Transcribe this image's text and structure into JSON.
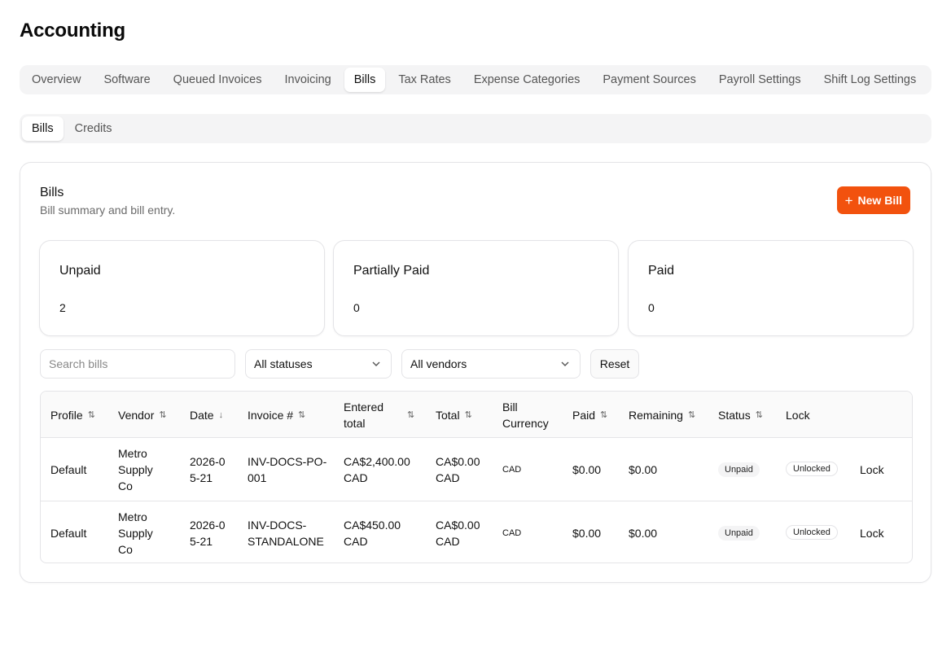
{
  "page": {
    "title": "Accounting"
  },
  "tabs": [
    {
      "label": "Overview",
      "active": false
    },
    {
      "label": "Software",
      "active": false
    },
    {
      "label": "Queued Invoices",
      "active": false
    },
    {
      "label": "Invoicing",
      "active": false
    },
    {
      "label": "Bills",
      "active": true
    },
    {
      "label": "Tax Rates",
      "active": false
    },
    {
      "label": "Expense Categories",
      "active": false
    },
    {
      "label": "Payment Sources",
      "active": false
    },
    {
      "label": "Payroll Settings",
      "active": false
    },
    {
      "label": "Shift Log Settings",
      "active": false
    }
  ],
  "subtabs": [
    {
      "label": "Bills",
      "active": true
    },
    {
      "label": "Credits",
      "active": false
    }
  ],
  "card": {
    "title": "Bills",
    "subtitle": "Bill summary and bill entry.",
    "new_button": "New Bill",
    "accent_color": "#f2520e"
  },
  "stats": [
    {
      "label": "Unpaid",
      "value": "2"
    },
    {
      "label": "Partially Paid",
      "value": "0"
    },
    {
      "label": "Paid",
      "value": "0"
    }
  ],
  "filters": {
    "search_placeholder": "Search bills",
    "status": "All statuses",
    "vendor": "All vendors",
    "reset": "Reset"
  },
  "table": {
    "columns": [
      {
        "label": "Profile",
        "sort": "⇅"
      },
      {
        "label": "Vendor",
        "sort": "⇅"
      },
      {
        "label": "Date",
        "sort": "↓"
      },
      {
        "label": "Invoice #",
        "sort": "⇅"
      },
      {
        "label": "Entered total",
        "sort": "⇅"
      },
      {
        "label": "Total",
        "sort": "⇅"
      },
      {
        "label": "Bill Currency",
        "sort": ""
      },
      {
        "label": "Paid",
        "sort": "⇅"
      },
      {
        "label": "Remaining",
        "sort": "⇅"
      },
      {
        "label": "Status",
        "sort": "⇅"
      },
      {
        "label": "Lock",
        "sort": ""
      }
    ],
    "rows": [
      {
        "profile": "Default",
        "vendor": "Metro Supply Co",
        "date": "2026-05-21",
        "invoice": "INV-DOCS-PO-001",
        "entered_total": "CA$2,400.00 CAD",
        "total": "CA$0.00 CAD",
        "currency": "CAD",
        "paid": "$0.00",
        "remaining": "$0.00",
        "status": "Unpaid",
        "lock_state": "Unlocked",
        "lock_action": "Lock"
      },
      {
        "profile": "Default",
        "vendor": "Metro Supply Co",
        "date": "2026-05-21",
        "invoice": "INV-DOCS-STANDALONE",
        "entered_total": "CA$450.00 CAD",
        "total": "CA$0.00 CAD",
        "currency": "CAD",
        "paid": "$0.00",
        "remaining": "$0.00",
        "status": "Unpaid",
        "lock_state": "Unlocked",
        "lock_action": "Lock"
      }
    ]
  }
}
